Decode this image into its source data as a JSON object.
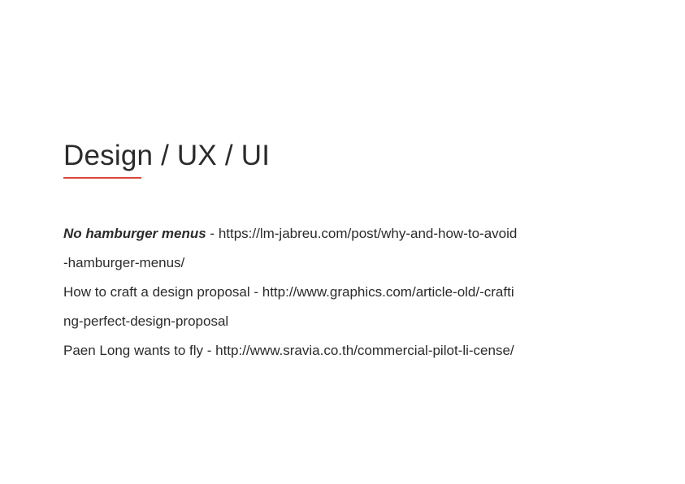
{
  "heading": {
    "title": "Design / UX / UI"
  },
  "entries": [
    {
      "title": "No hamburger menus",
      "separator": " - ",
      "url": "https://lm-jabreu.com/post/why-and-how-to-avoid-hamburger-menus/"
    },
    {
      "title": "How to craft a design proposal",
      "separator": " - ",
      "url": "http://www.graphics.com/article-old/-crafting-perfect-design-proposal"
    },
    {
      "title": "Paen Long wants to fly",
      "separator": " - ",
      "url": "http://www.sravia.co.th/commercial-pilot-li-cense/"
    }
  ],
  "colors": {
    "accent": "#d9473b",
    "text": "#2b2b2b"
  }
}
